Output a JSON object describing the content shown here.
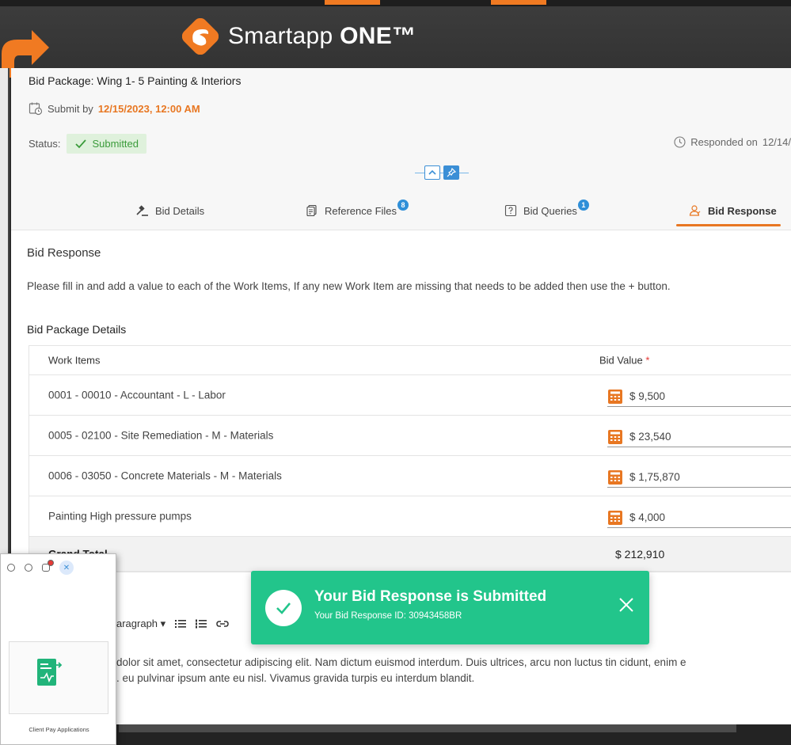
{
  "banner": {
    "brand_name": "Smartapp",
    "brand_suffix": "ONE™",
    "brand_color": "#f07a22"
  },
  "header": {
    "package_title": "Bid Package: Wing 1- 5 Painting & Interiors",
    "submit_by_label": "Submit by",
    "submit_by_date": "12/15/2023, 12:00 AM",
    "status_label": "Status:",
    "status_value": "Submitted",
    "responded_label": "Responded on",
    "responded_date": "12/14/"
  },
  "tabs": [
    {
      "label": "Bid Details",
      "icon": "gavel-icon",
      "badge": ""
    },
    {
      "label": "Reference Files",
      "icon": "files-icon",
      "badge": "8"
    },
    {
      "label": "Bid Queries",
      "icon": "question-icon",
      "badge": "1"
    },
    {
      "label": "Bid Response",
      "icon": "user-response-icon",
      "badge": ""
    }
  ],
  "main": {
    "section_title": "Bid Response",
    "instructions": "Please fill in and add a value to each of the Work Items, If any new Work Item are missing that needs to be added then use the + button.",
    "details_title": "Bid Package Details"
  },
  "table": {
    "col_work_items": "Work Items",
    "col_bid_value": "Bid Value",
    "required_mark": "*",
    "rows": [
      {
        "item": "0001 - 00010 - Accountant - L - Labor",
        "value": "$ 9,500"
      },
      {
        "item": "0005 - 02100 - Site Remediation - M - Materials",
        "value": "$ 23,540"
      },
      {
        "item": "0006 - 03050 - Concrete Materials - M - Materials",
        "value": "$ 1,75,870"
      },
      {
        "item": "Painting High pressure pumps",
        "value": "$ 4,000"
      }
    ],
    "total_label": "Grand Total",
    "total_value": "$ 212,910"
  },
  "editor": {
    "paragraph_label": "aragraph",
    "text_line1": "dolor sit amet, consectetur adipiscing elit. Nam dictum euismod interdum. Duis ultrices, arcu non luctus tin cidunt, enim e",
    "text_line2": ". eu pulvinar ipsum ante eu nisl. Vivamus gravida turpis eu interdum blandit."
  },
  "toast": {
    "title": "Your Bid Response is Submitted",
    "subtitle": "Your Bid Response ID: 30943458BR",
    "color": "#22c58b"
  },
  "mini_window": {
    "app_label": "Client Pay Applications",
    "notification_count": "1"
  }
}
